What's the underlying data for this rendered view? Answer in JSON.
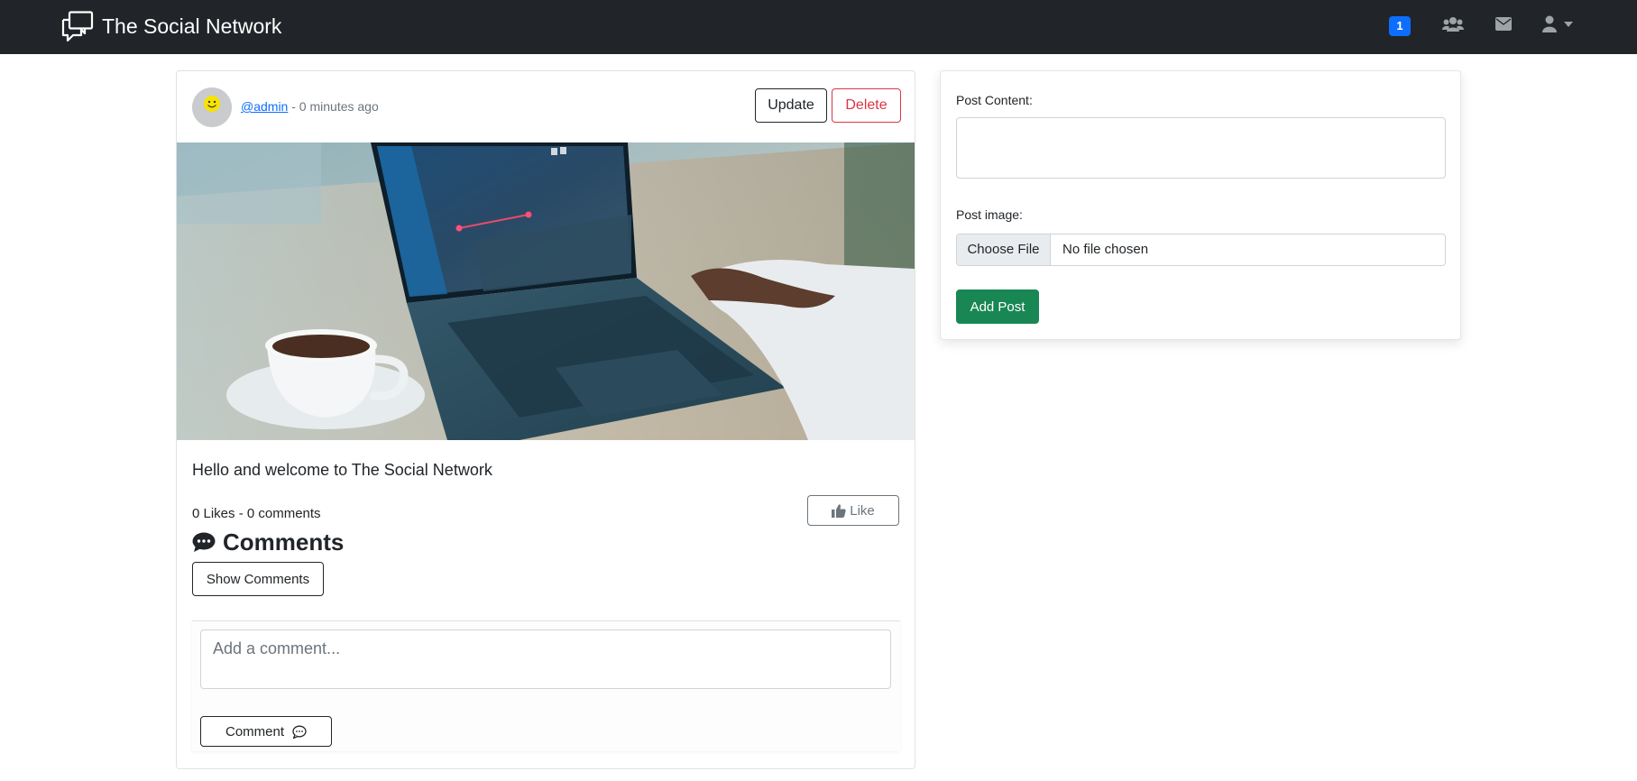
{
  "navbar": {
    "brand_name": "The Social Network",
    "notification_count": "1",
    "icons": [
      "chat-bubbles-logo-icon",
      "friends-icon",
      "envelope-icon",
      "user-icon",
      "caret-down-icon"
    ]
  },
  "post": {
    "author": "@admin",
    "time_separator": " - ",
    "time_ago": "0 minutes ago",
    "update_label": "Update",
    "delete_label": "Delete",
    "content": "Hello and welcome to The Social Network",
    "stats": "0 Likes - 0 comments",
    "like_label": "Like",
    "comments_heading": "Comments",
    "show_comments_label": "Show Comments",
    "comment_placeholder": "Add a comment...",
    "comment_button_label": "Comment"
  },
  "new_post_form": {
    "content_label": "Post Content:",
    "image_label": "Post image:",
    "choose_file_label": "Choose File",
    "file_status": "No file chosen",
    "submit_label": "Add Post"
  },
  "colors": {
    "navbar_bg": "#212529",
    "primary": "#0d6efd",
    "danger": "#dc3545",
    "success": "#198754",
    "muted": "#6c757d"
  }
}
